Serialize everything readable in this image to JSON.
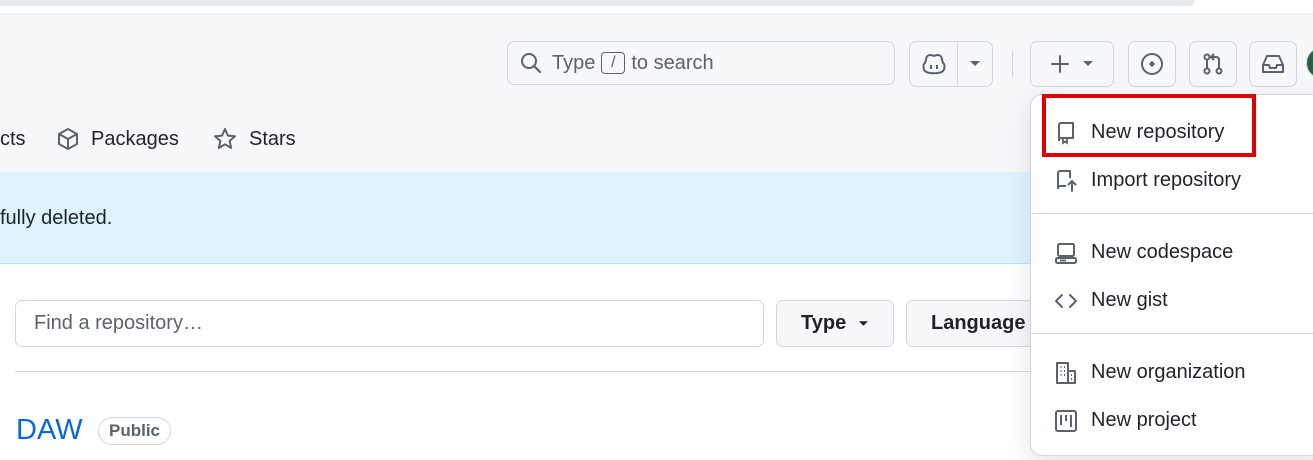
{
  "header": {
    "search": {
      "prefix": "Type",
      "kbd": "/",
      "suffix": "to search"
    },
    "create_button_icon": "plus-icon",
    "nav_tabs": [
      {
        "label": "cts",
        "icon": ""
      },
      {
        "label": "Packages",
        "icon": "package-icon"
      },
      {
        "label": "Stars",
        "icon": "star-icon"
      }
    ]
  },
  "flash": {
    "message": "fully deleted."
  },
  "repo_list": {
    "find_placeholder": "Find a repository…",
    "type_filter": "Type",
    "language_filter": "Language",
    "first_repo": {
      "name": "DAW",
      "visibility": "Public"
    }
  },
  "create_menu": {
    "items": [
      {
        "label": "New repository",
        "icon": "repo-icon"
      },
      {
        "label": "Import repository",
        "icon": "repo-push-icon"
      },
      {
        "label": "New codespace",
        "icon": "codespaces-icon"
      },
      {
        "label": "New gist",
        "icon": "code-icon"
      },
      {
        "label": "New organization",
        "icon": "organization-icon"
      },
      {
        "label": "New project",
        "icon": "project-icon"
      }
    ],
    "highlighted_item": "New repository",
    "highlight_color": "#e00000"
  },
  "colors": {
    "link": "#0969da",
    "flash_bg": "#ddf4ff",
    "header_bg": "#f6f8fa"
  }
}
